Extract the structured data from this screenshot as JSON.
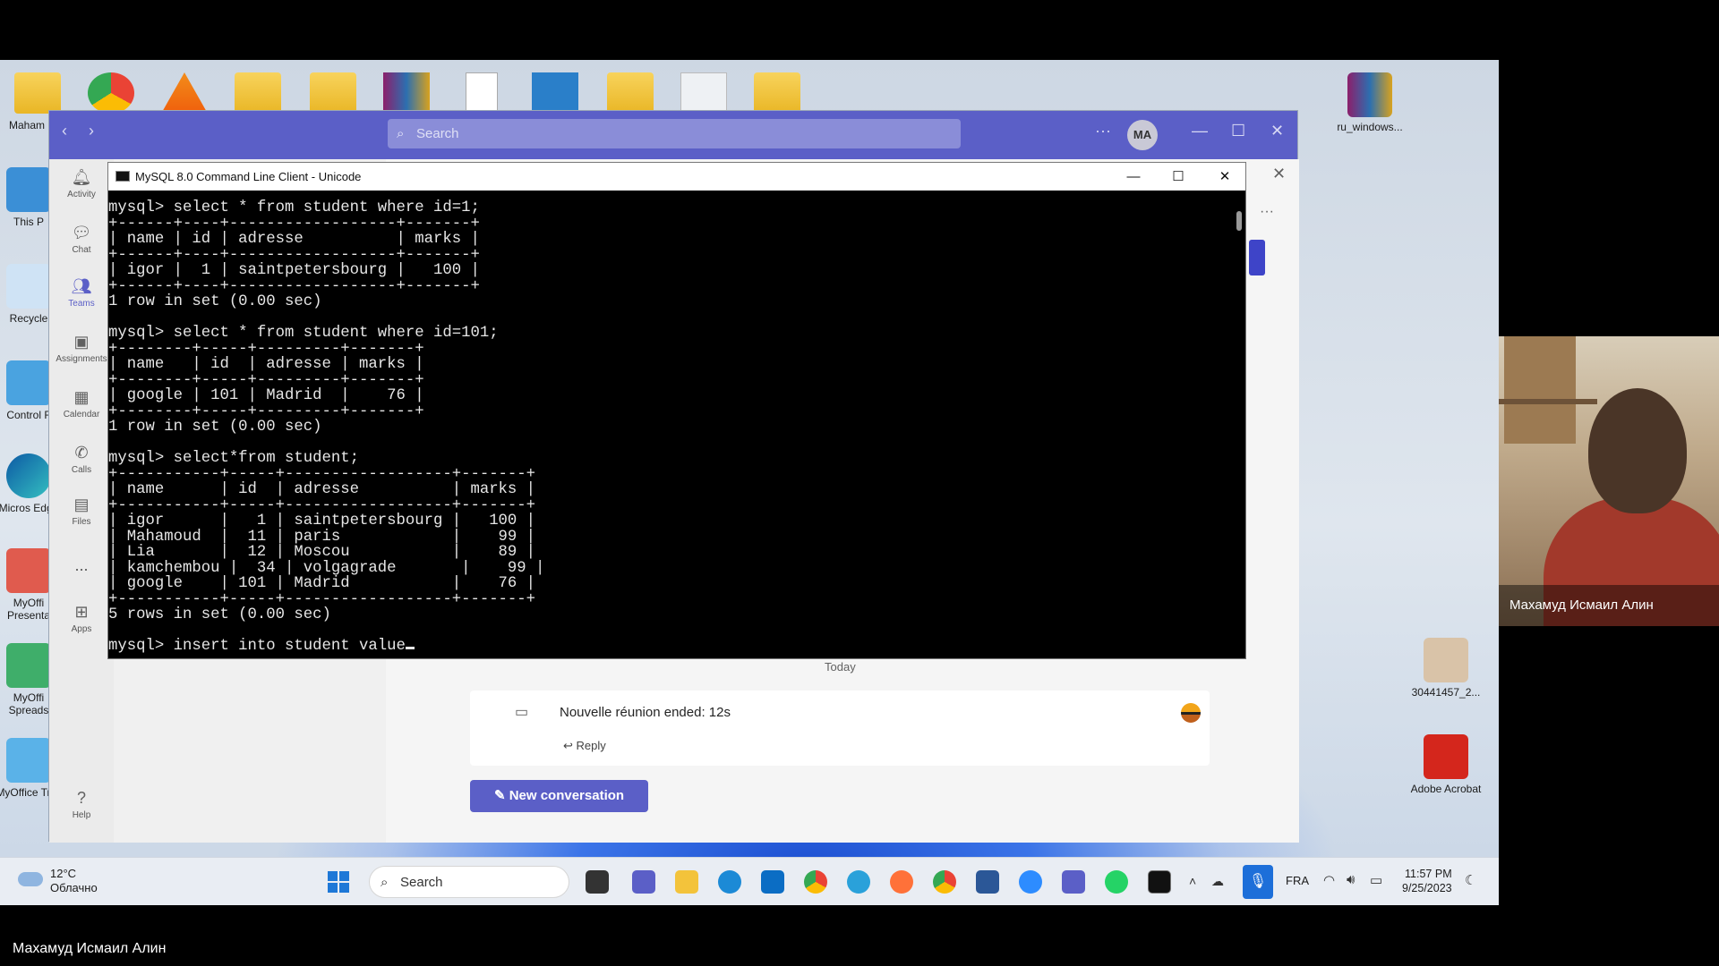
{
  "desktop": {
    "left_icons": [
      "Maham",
      "This P",
      "Recycle",
      "Control F",
      "Micros Edge",
      "MyOffi Presenta",
      "MyOffi Spreads",
      "MyOffice Trial"
    ],
    "right_icons": [
      "ru_windows...",
      "30441457_2...",
      "Adobe Acrobat"
    ]
  },
  "teams": {
    "search_placeholder": "Search",
    "avatar_initials": "MA",
    "rail": [
      {
        "label": "Activity",
        "icon": "bell-icon"
      },
      {
        "label": "Chat",
        "icon": "chat-icon"
      },
      {
        "label": "Teams",
        "icon": "teams-icon"
      },
      {
        "label": "Assignments",
        "icon": "assignments-icon"
      },
      {
        "label": "Calendar",
        "icon": "calendar-icon"
      },
      {
        "label": "Calls",
        "icon": "phone-icon"
      },
      {
        "label": "Files",
        "icon": "file-icon"
      },
      {
        "label": "...",
        "icon": "more-icon"
      },
      {
        "label": "Apps",
        "icon": "apps-icon"
      },
      {
        "label": "Help",
        "icon": "help-icon"
      }
    ],
    "today_label": "Today",
    "meeting_title": "Nouvelle réunion ended: 12s",
    "reply_label": "Reply",
    "new_conversation_label": "New conversation",
    "accent_color": "#5b5fc7"
  },
  "console": {
    "title": "MySQL 8.0 Command Line Client - Unicode",
    "lines": [
      "mysql> select * from student where id=1;",
      "+------+----+------------------+-------+",
      "| name | id | adresse          | marks |",
      "+------+----+------------------+-------+",
      "| igor |  1 | saintpetersbourg |   100 |",
      "+------+----+------------------+-------+",
      "1 row in set (0.00 sec)",
      "",
      "mysql> select * from student where id=101;",
      "+--------+-----+---------+-------+",
      "| name   | id  | adresse | marks |",
      "+--------+-----+---------+-------+",
      "| google | 101 | Madrid  |    76 |",
      "+--------+-----+---------+-------+",
      "1 row in set (0.00 sec)",
      "",
      "mysql> select*from student;",
      "+-----------+-----+------------------+-------+",
      "| name      | id  | adresse          | marks |",
      "+-----------+-----+------------------+-------+",
      "| igor      |   1 | saintpetersbourg |   100 |",
      "| Mahamoud  |  11 | paris            |    99 |",
      "| Lia       |  12 | Moscou           |    89 |",
      "| kamchembou |  34 | volgagrade       |    99 |",
      "| google    | 101 | Madrid           |    76 |",
      "+-----------+-----+------------------+-------+",
      "5 rows in set (0.00 sec)",
      ""
    ],
    "current_input": "mysql> insert into student value"
  },
  "webcam": {
    "participant_name": "Махамуд Исмаил Алин"
  },
  "taskbar": {
    "weather_temp": "12°C",
    "weather_desc": "Облачно",
    "search_label": "Search",
    "language": "FRA",
    "time": "11:57 PM",
    "date": "9/25/2023"
  },
  "presenter_caption": "Махамуд Исмаил Алин"
}
